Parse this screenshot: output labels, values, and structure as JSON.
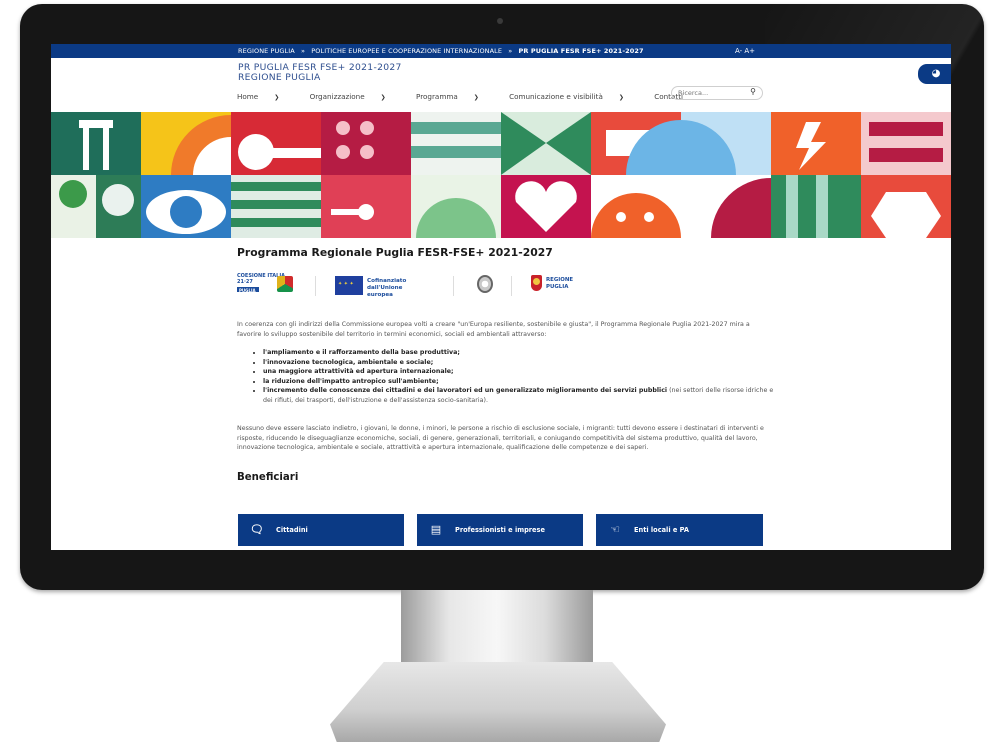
{
  "topbar": {
    "breadcrumbs": [
      "REGIONE PUGLIA",
      "»",
      "POLITICHE EUROPEE E COOPERAZIONE INTERNAZIONALE",
      "»"
    ],
    "current": "PR PUGLIA FESR FSE+ 2021-2027",
    "font_size_controls": "A-  A+"
  },
  "header": {
    "title_line1": "PR PUGLIA FESR FSE+ 2021-2027",
    "title_line2": "REGIONE PUGLIA",
    "user_icon": "user-badge-icon"
  },
  "nav": {
    "items": [
      {
        "label": "Home",
        "has_dropdown": true
      },
      {
        "label": "Organizzazione",
        "has_dropdown": true
      },
      {
        "label": "Programma",
        "has_dropdown": true
      },
      {
        "label": "Comunicazione e visibilità",
        "has_dropdown": true
      },
      {
        "label": "Contatti",
        "has_dropdown": false
      }
    ],
    "search_placeholder": "Ricerca..."
  },
  "main": {
    "page_title": "Programma Regionale Puglia FESR-FSE+ 2021-2027",
    "logos": {
      "coesione": "COESIONE ITALIA 21·27",
      "coesione_sub": "PUGLIA",
      "eu": "Cofinanziato dall'Unione europea",
      "regione": "REGIONE PUGLIA"
    },
    "intro": "In coerenza con gli indirizzi della Commissione europea volti a creare \"un'Europa resiliente, sostenibile e giusta\", il Programma Regionale Puglia 2021-2027 mira a favorire lo sviluppo sostenibile del territorio in termini economici, sociali ed ambientali attraverso:",
    "bullets": [
      {
        "bold": "l'ampliamento e il rafforzamento della base produttiva;",
        "rest": ""
      },
      {
        "bold": "l'innovazione tecnologica, ambientale e sociale;",
        "rest": ""
      },
      {
        "bold": "una maggiore attrattività ed apertura internazionale;",
        "rest": ""
      },
      {
        "bold": "la riduzione dell'impatto antropico sull'ambiente;",
        "rest": ""
      },
      {
        "bold": "l'incremento delle conoscenze dei cittadini e dei lavoratori ed un generalizzato miglioramento dei servizi pubblici",
        "rest": " (nei settori delle risorse idriche e dei rifiuti, dei trasporti, dell'istruzione e dell'assistenza socio-sanitaria)."
      }
    ],
    "closing": "Nessuno deve essere lasciato indietro, i giovani, le donne, i minori, le persone a rischio di esclusione sociale, i migranti: tutti devono essere i destinatari di interventi e risposte, riducendo le diseguaglianze economiche, sociali, di genere, generazionali, territoriali, e coniugando competitività del sistema produttivo, qualità del lavoro, innovazione tecnologica, ambientale e sociale, attrattività e apertura internazionale, qualificazione delle competenze e dei saperi.",
    "beneficiari_title": "Beneficiari",
    "beneficiari": [
      {
        "label": "Cittadini",
        "icon": "chat-bubbles-icon"
      },
      {
        "label": "Professionisti e imprese",
        "icon": "briefcase-icon"
      },
      {
        "label": "Enti locali e PA",
        "icon": "handshake-icon"
      }
    ]
  },
  "colors": {
    "brand_blue": "#0b3a85",
    "text_dark": "#1a1a1a"
  }
}
